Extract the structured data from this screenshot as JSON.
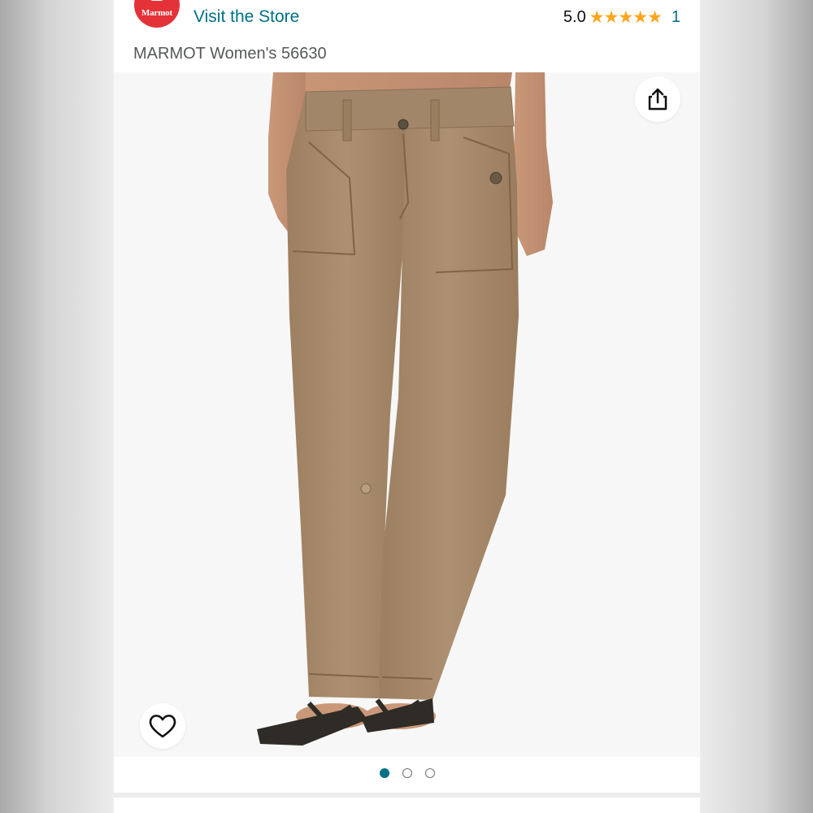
{
  "header": {
    "brand_logo_text": "Marmot",
    "visit_store_label": "Visit the Store",
    "rating_value": "5.0",
    "stars": "★★★★★",
    "rating_count": "1"
  },
  "product": {
    "title": "MARMOT Women's 56630",
    "image_subject": "khaki women's pants with sandals",
    "pants_color": "#a88c6d"
  },
  "carousel": {
    "active_index": 0,
    "total": 3
  },
  "colors": {
    "link": "#007185",
    "star": "#ffa41c",
    "brand_red": "#e53238"
  }
}
